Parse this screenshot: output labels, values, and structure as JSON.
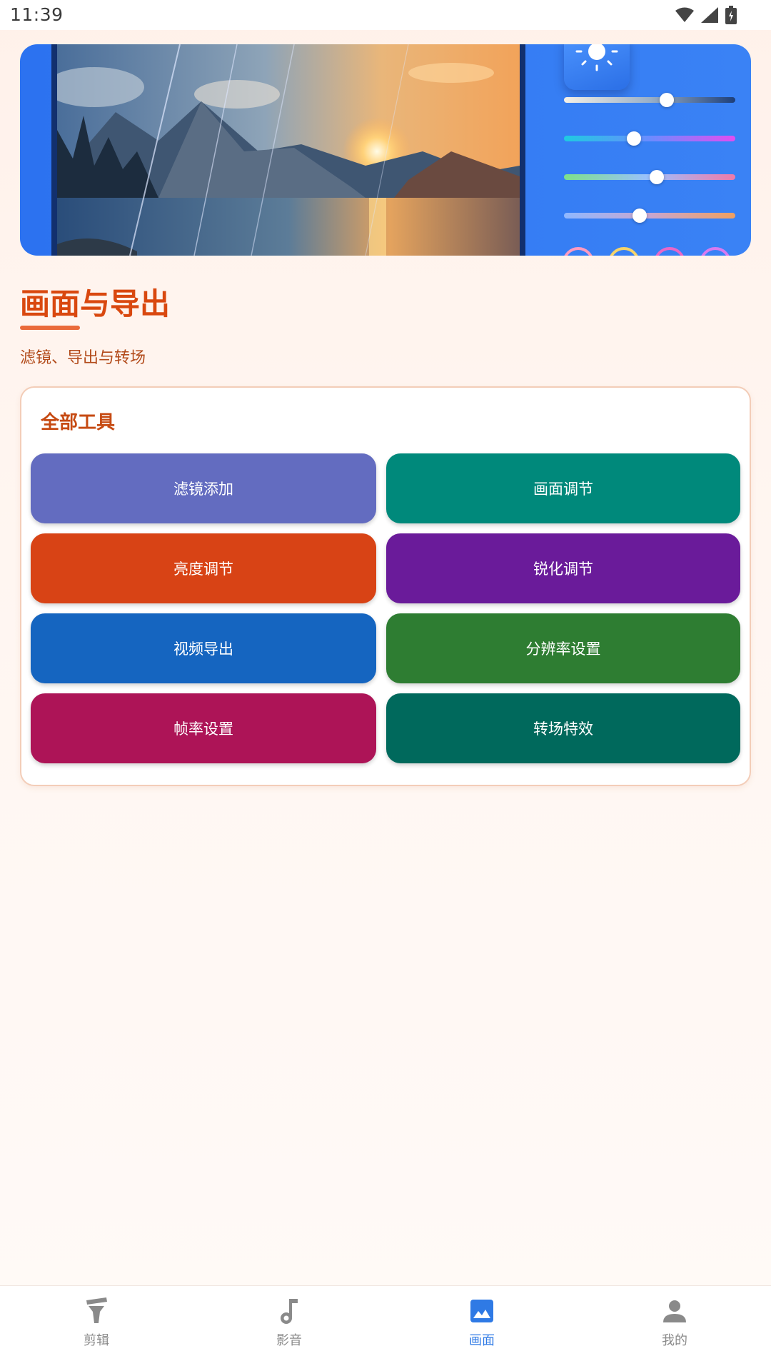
{
  "status_bar": {
    "time": "11:39",
    "icons": [
      "wifi-icon",
      "signal-icon",
      "battery-icon"
    ]
  },
  "banner": {
    "image": "mountain-lake-sunset-photo",
    "controls": [
      "sun-icon",
      "brightness-slider",
      "hue-slider",
      "saturation-slider",
      "temperature-slider",
      "color-rings"
    ],
    "slider_levels": [
      0.6,
      0.41,
      0.54,
      0.44
    ]
  },
  "header": {
    "title": "画面与导出",
    "subtitle": "滤镜、导出与转场"
  },
  "tools": {
    "title": "全部工具",
    "items": [
      {
        "label": "滤镜添加",
        "color": "#636cc0"
      },
      {
        "label": "画面调节",
        "color": "#00897b"
      },
      {
        "label": "亮度调节",
        "color": "#d84315"
      },
      {
        "label": "锐化调节",
        "color": "#6a1b9a"
      },
      {
        "label": "视频导出",
        "color": "#1565c0"
      },
      {
        "label": "分辨率设置",
        "color": "#2e7d32"
      },
      {
        "label": "帧率设置",
        "color": "#ad1457"
      },
      {
        "label": "转场特效",
        "color": "#00695c"
      }
    ]
  },
  "bottom_nav": {
    "active_color": "#2f7ae5",
    "items": [
      {
        "label": "剪辑",
        "icon": "clapperboard-icon",
        "active": false
      },
      {
        "label": "影音",
        "icon": "music-note-icon",
        "active": false
      },
      {
        "label": "画面",
        "icon": "image-icon",
        "active": true
      },
      {
        "label": "我的",
        "icon": "person-icon",
        "active": false
      }
    ]
  }
}
